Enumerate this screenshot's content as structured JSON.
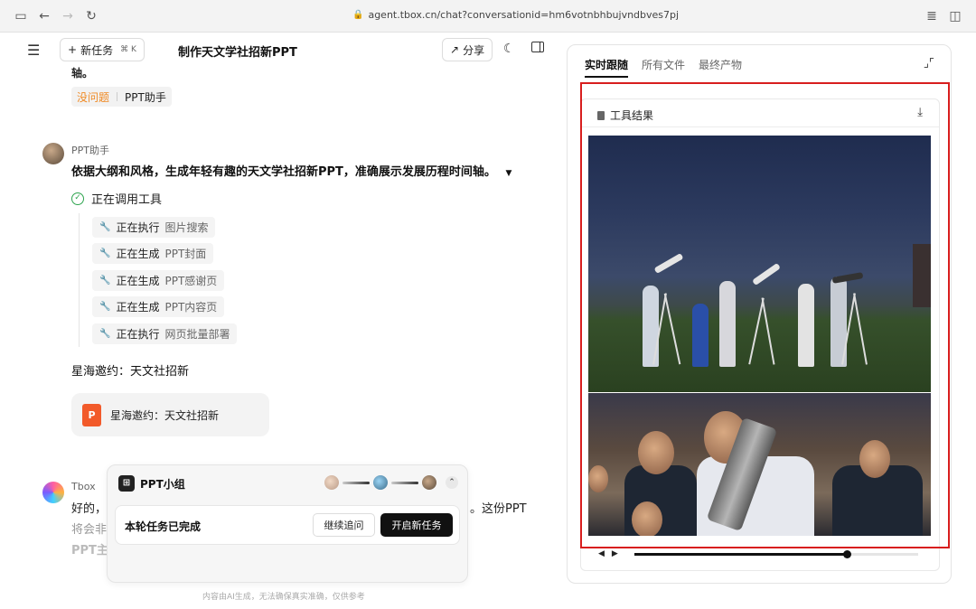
{
  "browser": {
    "url": "agent.tbox.cn/chat?conversationid=hm6votnbhbujvndbves7pj"
  },
  "header": {
    "new_task_label": "新任务",
    "shortcut": "⌘ K",
    "title": "制作天文学社招新PPT",
    "share_label": "分享"
  },
  "prev_message": {
    "truncated_text": "轴。",
    "tag_status": "没问题",
    "tag_agent": "PPT助手"
  },
  "assistant_message": {
    "sender": "PPT助手",
    "text": "依据大纲和风格，生成年轻有趣的天文学社招新PPT，准确展示发展历程时间轴。",
    "tool_status": "正在调用工具",
    "steps": [
      {
        "verb": "正在执行",
        "object": "图片搜索"
      },
      {
        "verb": "正在生成",
        "object": "PPT封面"
      },
      {
        "verb": "正在生成",
        "object": "PPT感谢页"
      },
      {
        "verb": "正在生成",
        "object": "PPT内容页"
      },
      {
        "verb": "正在执行",
        "object": "网页批量部署"
      }
    ],
    "ppt_title": "星海邀约：天文社招新",
    "ppt_file_name": "星海邀约：天文社招新",
    "ppt_icon_letter": "P"
  },
  "tbox_message": {
    "sender": "Tbox",
    "line1_start": "好的，",
    "line1_end": "。这份PPT",
    "line2": "将会非",
    "line3": "PPT主题"
  },
  "group_card": {
    "title": "PPT小组",
    "status": "本轮任务已完成",
    "continue_label": "继续追问",
    "new_task_label": "开启新任务"
  },
  "disclaimer": "内容由AI生成，无法确保真实准确，仅供参考",
  "right_panel": {
    "tabs": [
      "实时跟随",
      "所有文件",
      "最终产物"
    ],
    "active_tab": 0,
    "tool_result_label": "工具结果",
    "playback_progress": 0.75
  },
  "colors": {
    "highlight_border": "#d81e1e",
    "tag_orange": "#f08a24",
    "ppt_icon": "#f25a2a",
    "success_green": "#2da44e"
  }
}
